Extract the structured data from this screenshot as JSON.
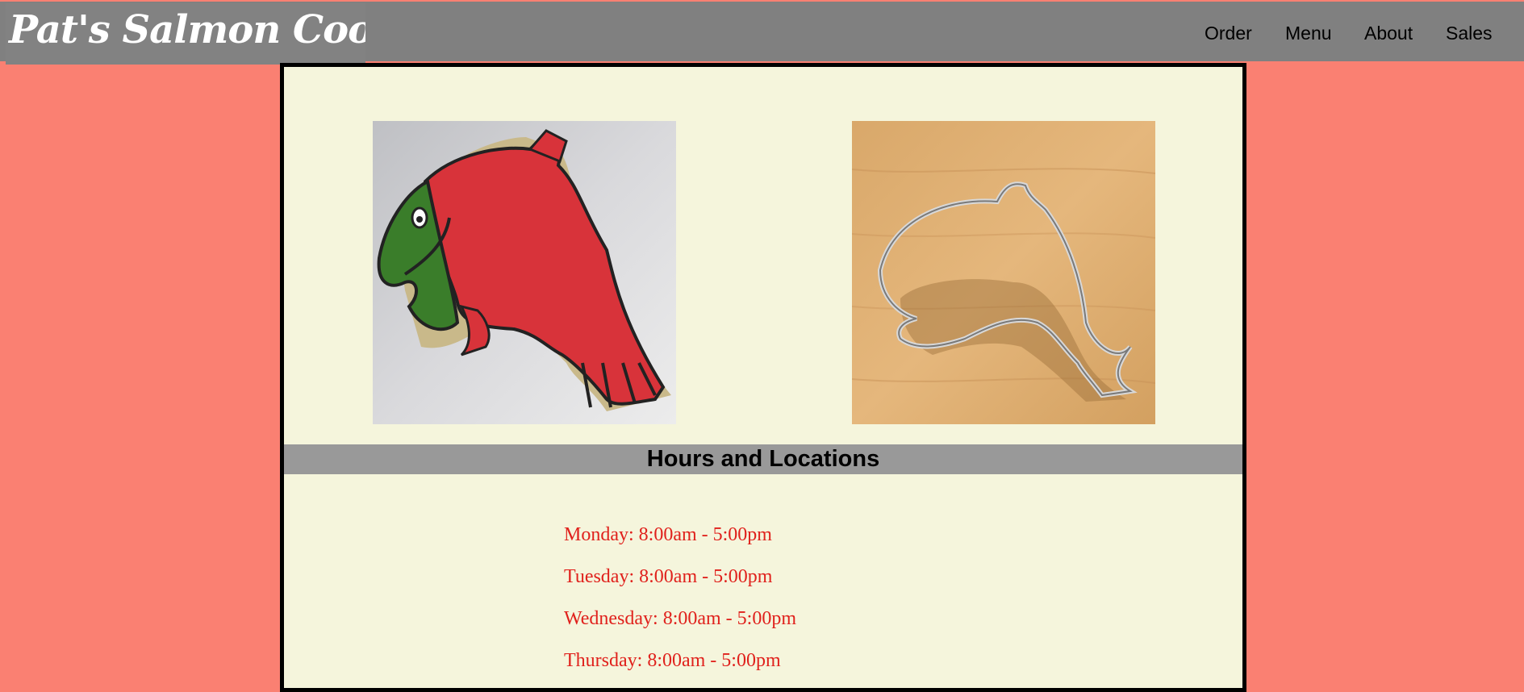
{
  "header": {
    "logo_text": "Pat's Salmon Cookies",
    "nav": [
      "Order",
      "Menu",
      "About",
      "Sales"
    ]
  },
  "images": [
    {
      "name": "salmon-cookie-photo"
    },
    {
      "name": "salmon-cookie-cutter-photo"
    }
  ],
  "hours": {
    "title": "Hours and Locations",
    "days": [
      "Monday: 8:00am - 5:00pm",
      "Tuesday: 8:00am - 5:00pm",
      "Wednesday: 8:00am - 5:00pm",
      "Thursday: 8:00am - 5:00pm"
    ]
  },
  "colors": {
    "background": "#fa8072",
    "header": "#808080",
    "panel": "#f5f5dc",
    "hours_bar": "#999999",
    "hours_text": "#e0211c"
  }
}
